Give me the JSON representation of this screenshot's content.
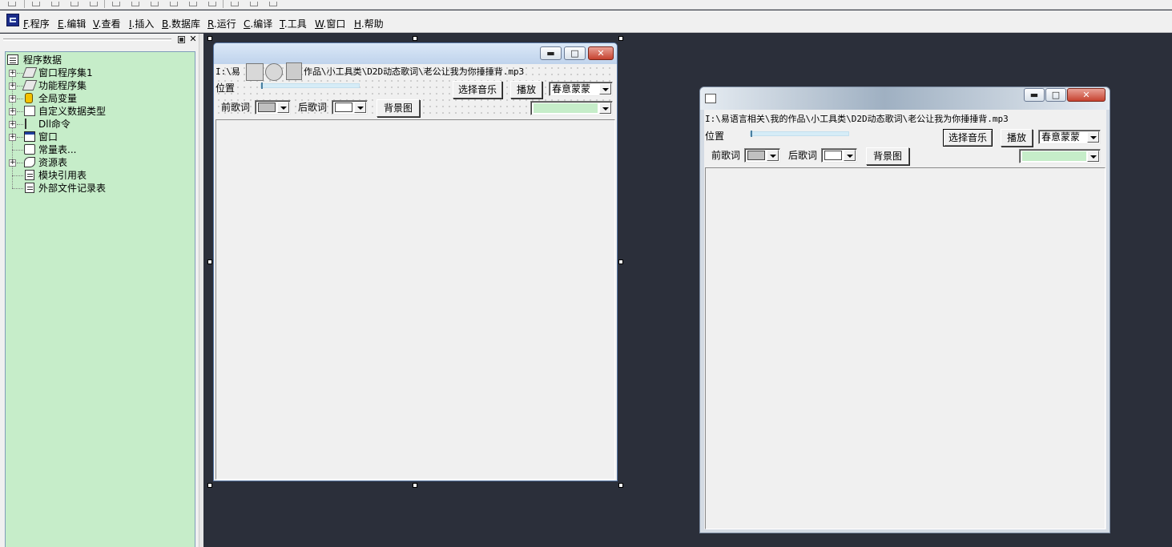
{
  "menubar": {
    "items": [
      {
        "key": "F",
        "label": ".程序"
      },
      {
        "key": "E",
        "label": ".编辑"
      },
      {
        "key": "V",
        "label": ".查看"
      },
      {
        "key": "I",
        "label": ".插入"
      },
      {
        "key": "B",
        "label": ".数据库"
      },
      {
        "key": "R",
        "label": ".运行"
      },
      {
        "key": "C",
        "label": ".编译"
      },
      {
        "key": "T",
        "label": ".工具"
      },
      {
        "key": "W",
        "label": ".窗口"
      },
      {
        "key": "H",
        "label": ".帮助"
      }
    ]
  },
  "tree": {
    "root": "程序数据",
    "items": [
      {
        "label": "窗口程序集1",
        "icon": "stack-icon",
        "expandable": true
      },
      {
        "label": "功能程序集",
        "icon": "stack-icon",
        "expandable": true
      },
      {
        "label": "全局变量",
        "icon": "globe-icon",
        "expandable": true
      },
      {
        "label": "自定义数据类型",
        "icon": "type-icon",
        "expandable": true
      },
      {
        "label": "Dll命令",
        "icon": "dll-icon",
        "expandable": true
      },
      {
        "label": "窗口",
        "icon": "window-icon",
        "expandable": true
      },
      {
        "label": "常量表...",
        "icon": "constant-icon",
        "expandable": false
      },
      {
        "label": "资源表",
        "icon": "resource-icon",
        "expandable": true
      },
      {
        "label": "模块引用表",
        "icon": "module-icon",
        "expandable": false
      },
      {
        "label": "外部文件记录表",
        "icon": "file-icon",
        "expandable": false
      }
    ],
    "tree_background": "#c6edc9"
  },
  "design_form": {
    "path": "I:\\易",
    "path_rest": "作品\\小工具类\\D2D动态歌词\\老公让我为你捶捶背.mp3",
    "position_label": "位置",
    "progress": 0.0,
    "select_music_label": "选择音乐",
    "play_label": "播放",
    "font_value": "春意蒙蒙",
    "prev_lyric_label": "前歌词",
    "next_lyric_label": "后歌词",
    "background_label": "背景图",
    "prev_color": "#c0c0c0",
    "next_color": "#ffffff",
    "bg_color": "#c6edc9"
  },
  "preview_form": {
    "path": "I:\\易语言相关\\我的作品\\小工具类\\D2D动态歌词\\老公让我为你捶捶背.mp3",
    "position_label": "位置",
    "progress": 0.0,
    "select_music_label": "选择音乐",
    "play_label": "播放",
    "font_value": "春意蒙蒙",
    "prev_lyric_label": "前歌词",
    "next_lyric_label": "后歌词",
    "background_label": "背景图",
    "prev_color": "#c0c0c0",
    "next_color": "#ffffff",
    "bg_color": "#c6edc9"
  },
  "colors": {
    "workspace": "#2b2f3a",
    "panel": "#f0f0f0",
    "accent_close": "#c6422f"
  }
}
